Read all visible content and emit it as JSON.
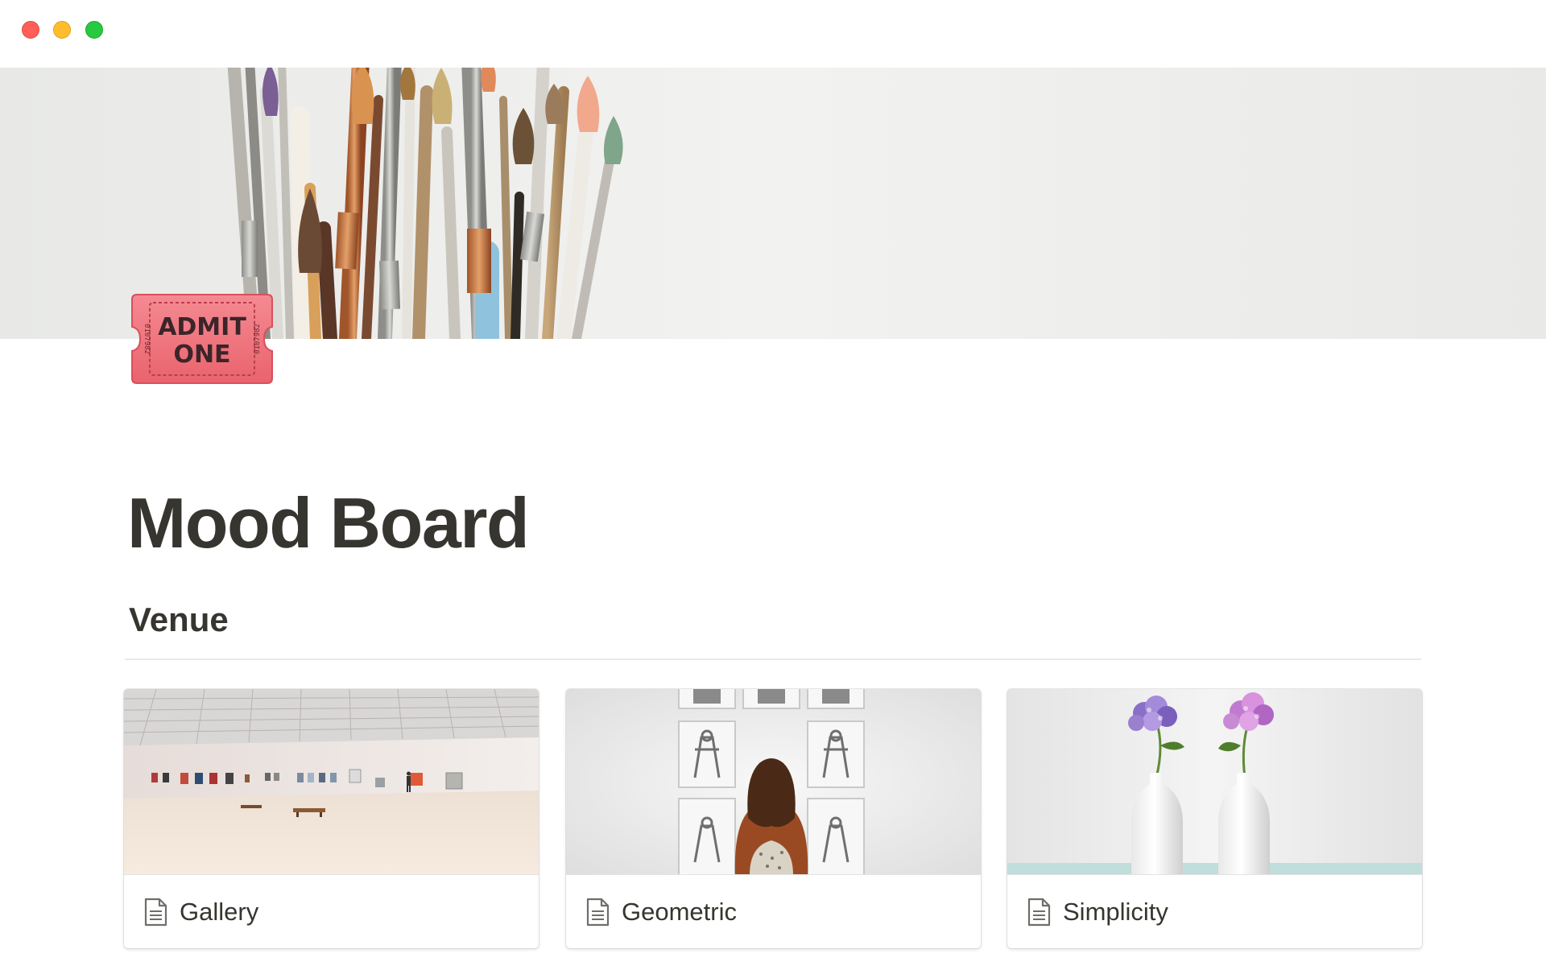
{
  "window": {
    "controls": [
      "close",
      "minimize",
      "maximize"
    ]
  },
  "page": {
    "cover_icon": "paintbrushes-cover",
    "icon": "admit-one-ticket-icon",
    "icon_text": [
      "ADMIT",
      "ONE"
    ],
    "icon_serial": "0107982",
    "title": "Mood Board"
  },
  "section": {
    "heading": "Venue"
  },
  "gallery": {
    "cards": [
      {
        "title": "Gallery",
        "icon": "page-icon",
        "cover": "white-gallery-hall-photo"
      },
      {
        "title": "Geometric",
        "icon": "page-icon",
        "cover": "woman-viewing-framed-photos"
      },
      {
        "title": "Simplicity",
        "icon": "page-icon",
        "cover": "hydrangeas-in-white-vases"
      }
    ]
  },
  "colors": {
    "text": "#37352f",
    "ticket": "#f0727a",
    "close": "#ff5f57",
    "minimize": "#febc2e",
    "maximize": "#28c840"
  }
}
